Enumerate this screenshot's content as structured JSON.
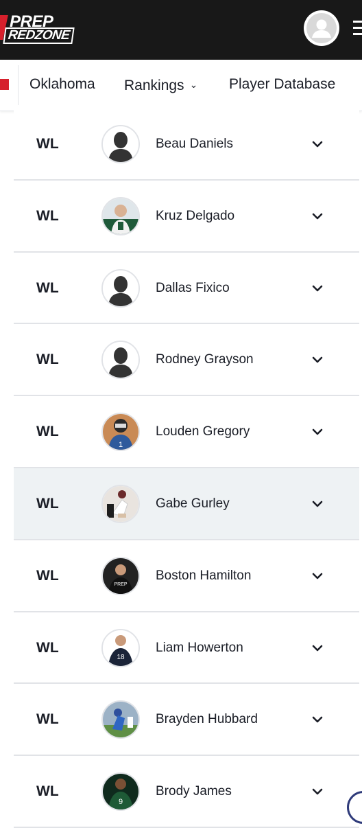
{
  "header": {
    "logo_line1": "PREP",
    "logo_line2": "REDZONE",
    "avatar_icon": "user-avatar-icon",
    "menu_icon": "hamburger-menu-icon",
    "background": "#181818",
    "accent": "#d6202c"
  },
  "subnav": {
    "state": "Oklahoma",
    "rankings": "Rankings",
    "rankings_icon": "chevron-down-icon",
    "player_database": "Player Database"
  },
  "players": [
    {
      "position": "WL",
      "name": "Beau Daniels",
      "photo": "placeholder",
      "highlighted": false
    },
    {
      "position": "WL",
      "name": "Kruz Delgado",
      "photo": "green-jersey",
      "highlighted": false
    },
    {
      "position": "WL",
      "name": "Dallas Fixico",
      "photo": "placeholder",
      "highlighted": false
    },
    {
      "position": "WL",
      "name": "Rodney Grayson",
      "photo": "placeholder",
      "highlighted": false
    },
    {
      "position": "WL",
      "name": "Louden Gregory",
      "photo": "blue-jersey",
      "highlighted": false
    },
    {
      "position": "WL",
      "name": "Gabe Gurley",
      "photo": "action-shot",
      "highlighted": true
    },
    {
      "position": "WL",
      "name": "Boston Hamilton",
      "photo": "black-shirt",
      "highlighted": false
    },
    {
      "position": "WL",
      "name": "Liam Howerton",
      "photo": "navy-jersey",
      "highlighted": false
    },
    {
      "position": "WL",
      "name": "Brayden Hubbard",
      "photo": "field-action",
      "highlighted": false
    },
    {
      "position": "WL",
      "name": "Brody James",
      "photo": "dark-green-jersey",
      "highlighted": false
    }
  ]
}
